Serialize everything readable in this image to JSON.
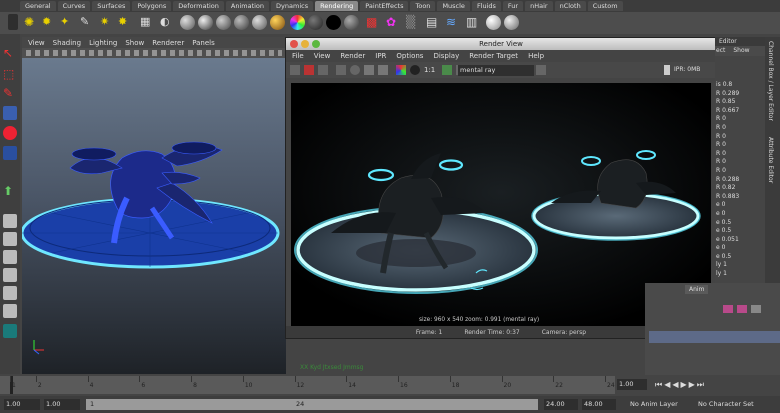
{
  "shelf_tabs": [
    "General",
    "Curves",
    "Surfaces",
    "Polygons",
    "Deformation",
    "Animation",
    "Dynamics",
    "Rendering",
    "PaintEffects",
    "Toon",
    "Muscle",
    "Fluids",
    "Fur",
    "nHair",
    "nCloth",
    "Custom"
  ],
  "shelf_active": "Rendering",
  "viewport": {
    "menu": [
      "View",
      "Shading",
      "Lighting",
      "Show",
      "Renderer",
      "Panels"
    ],
    "camera_label": "XX Kyd Jtxsed Jmmsg"
  },
  "render_view": {
    "title": "Render View",
    "menu": [
      "File",
      "View",
      "Render",
      "IPR",
      "Options",
      "Display",
      "Render Target",
      "Help"
    ],
    "ratio": "1:1",
    "renderer": "mental ray",
    "ipr_label": "IPR: 0MB",
    "overlay": "size: 960 x 540  zoom: 0.991      (mental ray)",
    "status_frame": "Frame: 1",
    "status_time": "Render Time: 0:37",
    "status_camera": "Camera: persp"
  },
  "channel_box": {
    "header": "Editor",
    "menu": [
      "ect",
      "Show"
    ],
    "rows": [
      {
        "name": "is",
        "value": "0.8"
      },
      {
        "name": "R",
        "value": "0.289"
      },
      {
        "name": "R",
        "value": "0.85"
      },
      {
        "name": "R",
        "value": "0.667"
      },
      {
        "name": "R",
        "value": "0"
      },
      {
        "name": "R",
        "value": "0"
      },
      {
        "name": "R",
        "value": "0"
      },
      {
        "name": "R",
        "value": "0"
      },
      {
        "name": "R",
        "value": "0"
      },
      {
        "name": "R",
        "value": "0"
      },
      {
        "name": "R",
        "value": "0"
      },
      {
        "name": "R",
        "value": "0.288"
      },
      {
        "name": "R",
        "value": "0.82"
      },
      {
        "name": "R",
        "value": "0.883"
      },
      {
        "name": "e",
        "value": "0"
      },
      {
        "name": "e",
        "value": "0"
      },
      {
        "name": "e",
        "value": "0.5"
      },
      {
        "name": "e",
        "value": "0.5"
      },
      {
        "name": "e",
        "value": "0.051"
      },
      {
        "name": "e",
        "value": "0"
      },
      {
        "name": "e",
        "value": "0.5"
      },
      {
        "name": "ly",
        "value": "1"
      },
      {
        "name": "ly",
        "value": "1"
      }
    ],
    "vtabs": [
      "Channel Box / Layer Editor",
      "Attribute Editor"
    ],
    "layer_tab": "Anim"
  },
  "time_slider": {
    "ticks": [
      "1",
      "2",
      "4",
      "6",
      "8",
      "10",
      "12",
      "14",
      "16",
      "18",
      "20",
      "22",
      "24"
    ],
    "current": "1.00"
  },
  "range": {
    "start": "1.00",
    "start2": "1.00",
    "slider_start": "1",
    "slider_end": "24",
    "end": "24.00",
    "end2": "48.00",
    "anim_layer": "No Anim Layer",
    "char_set": "No Character Set"
  }
}
